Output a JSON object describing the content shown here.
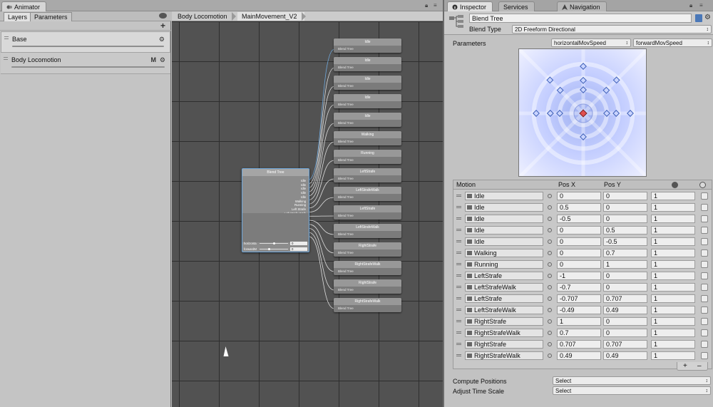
{
  "animator": {
    "window_tab": "Animator",
    "subtabs": [
      "Layers",
      "Parameters"
    ],
    "layers": [
      {
        "name": "Base"
      },
      {
        "name": "Body Locomotion"
      }
    ],
    "breadcrumbs": [
      "Body Locomotion",
      "MainMovement_V2"
    ],
    "blend_tree_node": {
      "title": "Blend Tree",
      "motions": [
        "Idle",
        "Idle",
        "Idle",
        "Idle",
        "Idle",
        "Walking",
        "Running",
        "Left Strafe",
        "Left Strafe Walk",
        "Left Strafe",
        "Left Strafe Walk",
        "Right Strafe",
        "Right Strafe Walk",
        "Right Strafe",
        "Right Strafe Walk"
      ],
      "params": [
        {
          "name": "horizonta",
          "value": "0"
        },
        {
          "name": "forwardM",
          "value": "0"
        }
      ]
    },
    "child_nodes": [
      {
        "title": "Idle",
        "sub": "Blend Tree"
      },
      {
        "title": "Idle",
        "sub": "Blend Tree"
      },
      {
        "title": "Idle",
        "sub": "Blend Tree"
      },
      {
        "title": "Idle",
        "sub": "Blend Tree"
      },
      {
        "title": "Idle",
        "sub": "Blend Tree"
      },
      {
        "title": "Walking",
        "sub": "Blend Tree"
      },
      {
        "title": "Running",
        "sub": "Blend Tree"
      },
      {
        "title": "LeftStrafe",
        "sub": "Blend Tree"
      },
      {
        "title": "LeftStrafeWalk",
        "sub": "Blend Tree"
      },
      {
        "title": "LeftStrafe",
        "sub": "Blend Tree"
      },
      {
        "title": "LeftStrafeWalk",
        "sub": "Blend Tree"
      },
      {
        "title": "RightStrafe",
        "sub": "Blend Tree"
      },
      {
        "title": "RightStrafeWalk",
        "sub": "Blend Tree"
      },
      {
        "title": "RightStrafe",
        "sub": "Blend Tree"
      },
      {
        "title": "RightStrafeWalk",
        "sub": "Blend Tree"
      }
    ]
  },
  "inspector": {
    "tabs": [
      "Inspector",
      "Services",
      "Navigation"
    ],
    "title": "Blend Tree",
    "blend_type_label": "Blend Type",
    "blend_type_value": "2D Freeform Directional",
    "parameters_label": "Parameters",
    "param_x": "horizontalMovSpeed",
    "param_y": "forwardMovSpeed",
    "table_headers": {
      "motion": "Motion",
      "posx": "Pos X",
      "posy": "Pos Y"
    },
    "motions": [
      {
        "name": "Idle",
        "x": "0",
        "y": "0",
        "speed": "1"
      },
      {
        "name": "Idle",
        "x": "0.5",
        "y": "0",
        "speed": "1"
      },
      {
        "name": "Idle",
        "x": "-0.5",
        "y": "0",
        "speed": "1"
      },
      {
        "name": "Idle",
        "x": "0",
        "y": "0.5",
        "speed": "1"
      },
      {
        "name": "Idle",
        "x": "0",
        "y": "-0.5",
        "speed": "1"
      },
      {
        "name": "Walking",
        "x": "0",
        "y": "0.7",
        "speed": "1"
      },
      {
        "name": "Running",
        "x": "0",
        "y": "1",
        "speed": "1"
      },
      {
        "name": "LeftStrafe",
        "x": "-1",
        "y": "0",
        "speed": "1"
      },
      {
        "name": "LeftStrafeWalk",
        "x": "-0.7",
        "y": "0",
        "speed": "1"
      },
      {
        "name": "LeftStrafe",
        "x": "-0.707",
        "y": "0.707",
        "speed": "1"
      },
      {
        "name": "LeftStrafeWalk",
        "x": "-0.49",
        "y": "0.49",
        "speed": "1"
      },
      {
        "name": "RightStrafe",
        "x": "1",
        "y": "0",
        "speed": "1"
      },
      {
        "name": "RightStrafeWalk",
        "x": "0.7",
        "y": "0",
        "speed": "1"
      },
      {
        "name": "RightStrafe",
        "x": "0.707",
        "y": "0.707",
        "speed": "1"
      },
      {
        "name": "RightStrafeWalk",
        "x": "0.49",
        "y": "0.49",
        "speed": "1"
      }
    ],
    "compute_positions_label": "Compute Positions",
    "compute_positions_value": "Select",
    "adjust_time_scale_label": "Adjust Time Scale",
    "adjust_time_scale_value": "Select",
    "add_symbol": "+",
    "remove_symbol": "–"
  },
  "colors": {
    "graph_bg": "#525252",
    "selection": "#6fa8dc",
    "point": "#6a8fd8",
    "current_point": "#e05050"
  }
}
